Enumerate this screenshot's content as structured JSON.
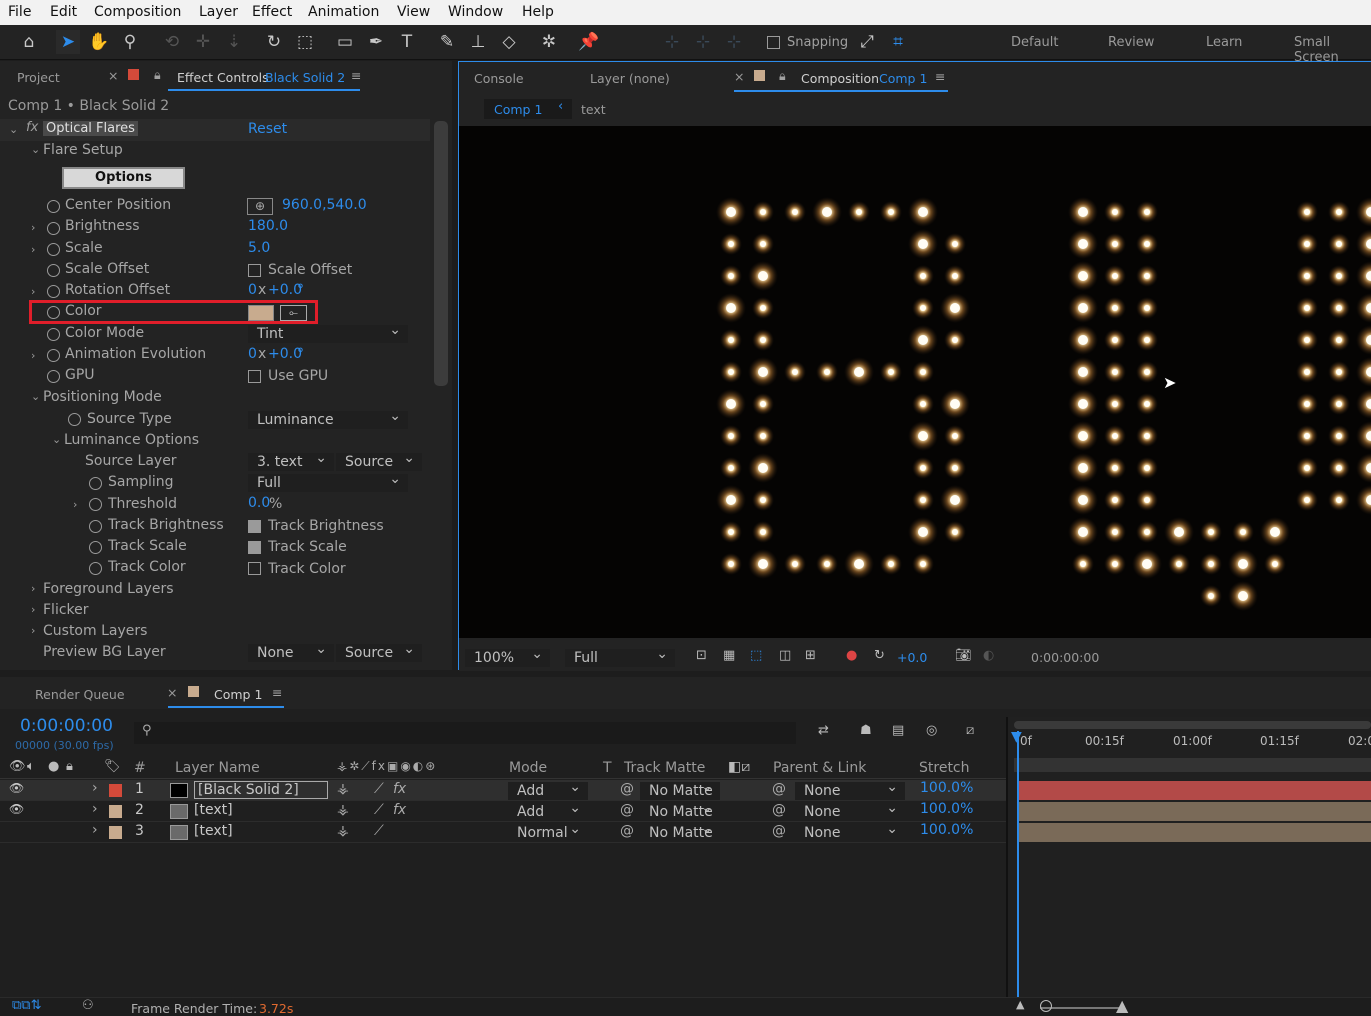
{
  "menu": [
    "File",
    "Edit",
    "Composition",
    "Layer",
    "Effect",
    "Animation",
    "View",
    "Window",
    "Help"
  ],
  "toolbar": {
    "snapping_label": "Snapping",
    "workspaces": [
      "Default",
      "Review",
      "Learn",
      "Small Screen"
    ]
  },
  "left_panel": {
    "tab_project": "Project",
    "tab_effect_controls": "Effect Controls",
    "tab_effect_layer": "Black Solid 2",
    "breadcrumb": "Comp 1 • Black Solid 2",
    "effect_name": "Optical Flares",
    "reset": "Reset",
    "flare_setup": "Flare Setup",
    "options_button": "Options",
    "props": {
      "center_position": {
        "label": "Center Position",
        "value": "960.0,540.0"
      },
      "brightness": {
        "label": "Brightness",
        "value": "180.0"
      },
      "scale": {
        "label": "Scale",
        "value": "5.0"
      },
      "scale_offset": {
        "label": "Scale Offset",
        "check_label": "Scale Offset"
      },
      "rotation_offset": {
        "label": "Rotation Offset",
        "value_a": "0",
        "value_x": "x",
        "value_b": "+0.0",
        "unit": "°"
      },
      "color": {
        "label": "Color",
        "swatch": "#c8ab8e"
      },
      "color_mode": {
        "label": "Color Mode",
        "value": "Tint"
      },
      "animation_evolution": {
        "label": "Animation Evolution",
        "value_a": "0",
        "value_x": "x",
        "value_b": "+0.0",
        "unit": "°"
      },
      "gpu": {
        "label": "GPU",
        "check_label": "Use GPU"
      },
      "positioning_mode": "Positioning Mode",
      "source_type": {
        "label": "Source Type",
        "value": "Luminance"
      },
      "luminance_options": "Luminance Options",
      "source_layer": {
        "label": "Source Layer",
        "value": "3. text",
        "value2": "Source"
      },
      "sampling": {
        "label": "Sampling",
        "value": "Full"
      },
      "threshold": {
        "label": "Threshold",
        "value": "0.0",
        "unit": "%"
      },
      "track_brightness": {
        "label": "Track Brightness",
        "check_label": "Track Brightness"
      },
      "track_scale": {
        "label": "Track Scale",
        "check_label": "Track Scale"
      },
      "track_color": {
        "label": "Track Color",
        "check_label": "Track Color"
      },
      "foreground_layers": "Foreground Layers",
      "flicker": "Flicker",
      "custom_layers": "Custom Layers",
      "preview_bg_layer": {
        "label": "Preview BG Layer",
        "value": "None",
        "value2": "Source"
      }
    }
  },
  "viewer": {
    "tab_console": "Console",
    "tab_layer": "Layer (none)",
    "tab_composition": "Composition",
    "tab_comp_name": "Comp 1",
    "crumb_comp": "Comp 1",
    "crumb_text": "text",
    "zoom": "100%",
    "resolution": "Full",
    "exposure": "+0.0",
    "timecode": "0:00:00:00"
  },
  "timeline": {
    "tab_render_queue": "Render Queue",
    "tab_comp": "Comp 1",
    "timecode": "0:00:00:00",
    "frames": "00000 (30.00 fps)",
    "col_hash": "#",
    "col_layer_name": "Layer Name",
    "col_mode": "Mode",
    "col_t": "T",
    "col_track_matte": "Track Matte",
    "col_parent": "Parent & Link",
    "col_stretch": "Stretch",
    "ruler": [
      "0f",
      "00:15f",
      "01:00f",
      "01:15f",
      "02:0"
    ],
    "layers": [
      {
        "num": "1",
        "name": "[Black Solid 2]",
        "mode": "Add",
        "matte": "No Matte",
        "parent": "None",
        "stretch": "100.0%",
        "label_color": "#d44a3a",
        "bar_color": "#b34a48"
      },
      {
        "num": "2",
        "name": "[text]",
        "mode": "Add",
        "matte": "No Matte",
        "parent": "None",
        "stretch": "100.0%",
        "label_color": "#c8ab8e",
        "bar_color": "#7a6a58"
      },
      {
        "num": "3",
        "name": "[text]",
        "mode": "Normal",
        "matte": "No Matte",
        "parent": "None",
        "stretch": "100.0%",
        "label_color": "#c8ab8e",
        "bar_color": "#7a6a58"
      }
    ],
    "footer_label": "Frame Render Time:",
    "footer_value": "3.72s"
  }
}
